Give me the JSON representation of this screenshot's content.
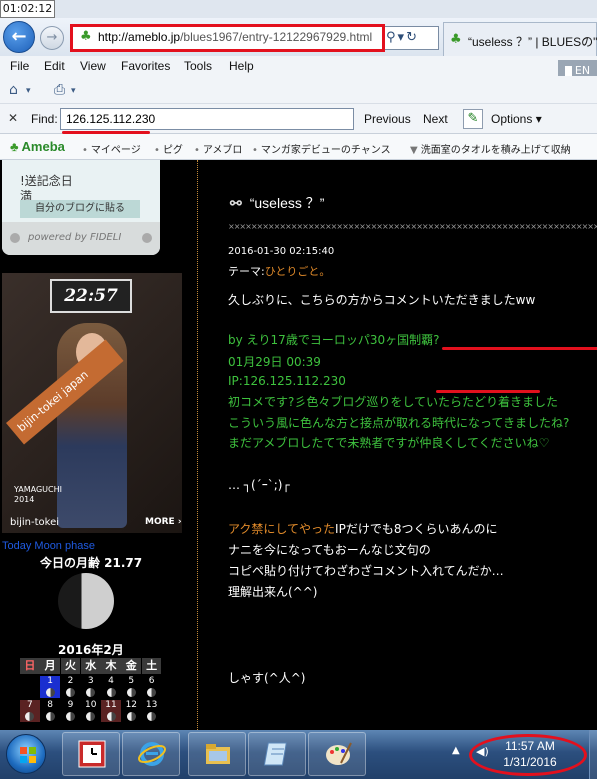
{
  "clock_tooltip": "01:02:12",
  "address_bar": {
    "url_domain": "http://ameblo.jp",
    "url_rest": "/blues1967/entry-12122967929.html",
    "tab_title": "“useless ？” | BLUESの\"B"
  },
  "menu": [
    "File",
    "Edit",
    "View",
    "Favorites",
    "Tools",
    "Help"
  ],
  "language": "EN",
  "find_bar": {
    "label": "Find:",
    "value": "126.125.112.230",
    "previous": "Previous",
    "next": "Next",
    "options": "Options"
  },
  "favorites_bar": {
    "brand": "Ameba",
    "links": [
      "マイページ",
      "ピグ",
      "アメブロ",
      "マンガ家デビューのチャンス",
      "洗面室のタオルを積み上げて収納"
    ]
  },
  "sidebar": {
    "widget_lines": [
      "!送記念日",
      "満"
    ],
    "widget_button": "自分のブログに貼る",
    "widget_footer": "powered by FIDELI",
    "ad_board": "22:57",
    "ad_sash": "bijin-tokei japan",
    "ad_sub1": "YAMAGUCHI",
    "ad_sub2": "2014",
    "ad_brand": "bijin-tokei",
    "ad_more": "MORE ›",
    "moon_title": "Today Moon phase",
    "moon_age": "今日の月齢 21.77",
    "calendar_title": "2016年2月",
    "calendar_head": [
      "日",
      "月",
      "火",
      "水",
      "木",
      "金",
      "土"
    ],
    "calendar_rows": [
      [
        "",
        "1",
        "2",
        "3",
        "4",
        "5",
        "6"
      ],
      [
        "7",
        "8",
        "9",
        "10",
        "11",
        "12",
        "13"
      ]
    ]
  },
  "post": {
    "title": "“useless ？”",
    "separator": "××××××××××××××××××××××××××××××××××××××××××××××××××××××××××××××××××××",
    "datetime": "2016-01-30 02:15:40",
    "theme_label": "テーマ:",
    "theme": "ひとりごと。",
    "line1": "久しぶりに、こちらの方からコメントいただきましたww",
    "by_prefix": "by ",
    "by_name": "えり17歳でヨーロッパ30ヶ国制覇?",
    "comment_date": "01月29日 00:39",
    "ip_label": "IP:",
    "ip": "126.125.112.230",
    "comment1": "初コメです?彡色々ブログ巡りをしていたらたどり着きました",
    "comment2": "こういう風に色んな方と接点が取れる時代になってきましたね?",
    "comment3": "まだアメブロしたてで未熟者ですが仲良くしてくださいね♡",
    "face1": "… ┐(´ｰ`;)┌",
    "reply_orange": "アク禁にしてやった",
    "reply1_rest": "IPだけでも8つくらいあんのに",
    "reply2": "ナニを今になってもおーんなじ文句の",
    "reply3": "コピペ貼り付けてわざわざコメント入れてんだか…",
    "reply4": "理解出来ん(^^)",
    "bye": "しゃす(^人^)"
  },
  "taskbar": {
    "time": "11:57 AM",
    "date": "1/31/2016"
  },
  "colors": {
    "highlight_red": "#e3101d",
    "comment_green": "#3ec23e",
    "theme_orange": "#e08a2a"
  }
}
